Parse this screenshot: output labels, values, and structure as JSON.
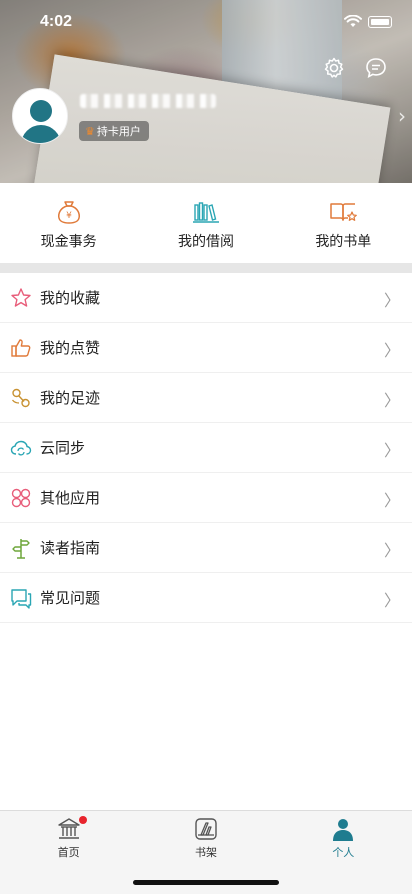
{
  "status_bar": {
    "time": "4:02"
  },
  "profile": {
    "badge_label": "持卡用户"
  },
  "quick_actions": [
    {
      "label": "现金事务",
      "icon": "money-bag-icon"
    },
    {
      "label": "我的借阅",
      "icon": "books-icon"
    },
    {
      "label": "我的书单",
      "icon": "book-star-icon"
    }
  ],
  "menu": [
    {
      "label": "我的收藏",
      "icon": "star-icon"
    },
    {
      "label": "我的点赞",
      "icon": "thumbs-up-icon"
    },
    {
      "label": "我的足迹",
      "icon": "footprint-icon"
    },
    {
      "label": "云同步",
      "icon": "cloud-sync-icon"
    },
    {
      "label": "其他应用",
      "icon": "apps-icon"
    },
    {
      "label": "读者指南",
      "icon": "signpost-icon"
    },
    {
      "label": "常见问题",
      "icon": "faq-chat-icon"
    }
  ],
  "tabbar": [
    {
      "label": "首页",
      "icon": "library-icon"
    },
    {
      "label": "书架",
      "icon": "bookshelf-icon"
    },
    {
      "label": "个人",
      "icon": "person-icon"
    }
  ],
  "colors": {
    "accent": "#1f7c8f",
    "icon_orange": "#e07a3a",
    "icon_teal": "#2aa6b4",
    "tab_active": "#1f7c8f"
  }
}
